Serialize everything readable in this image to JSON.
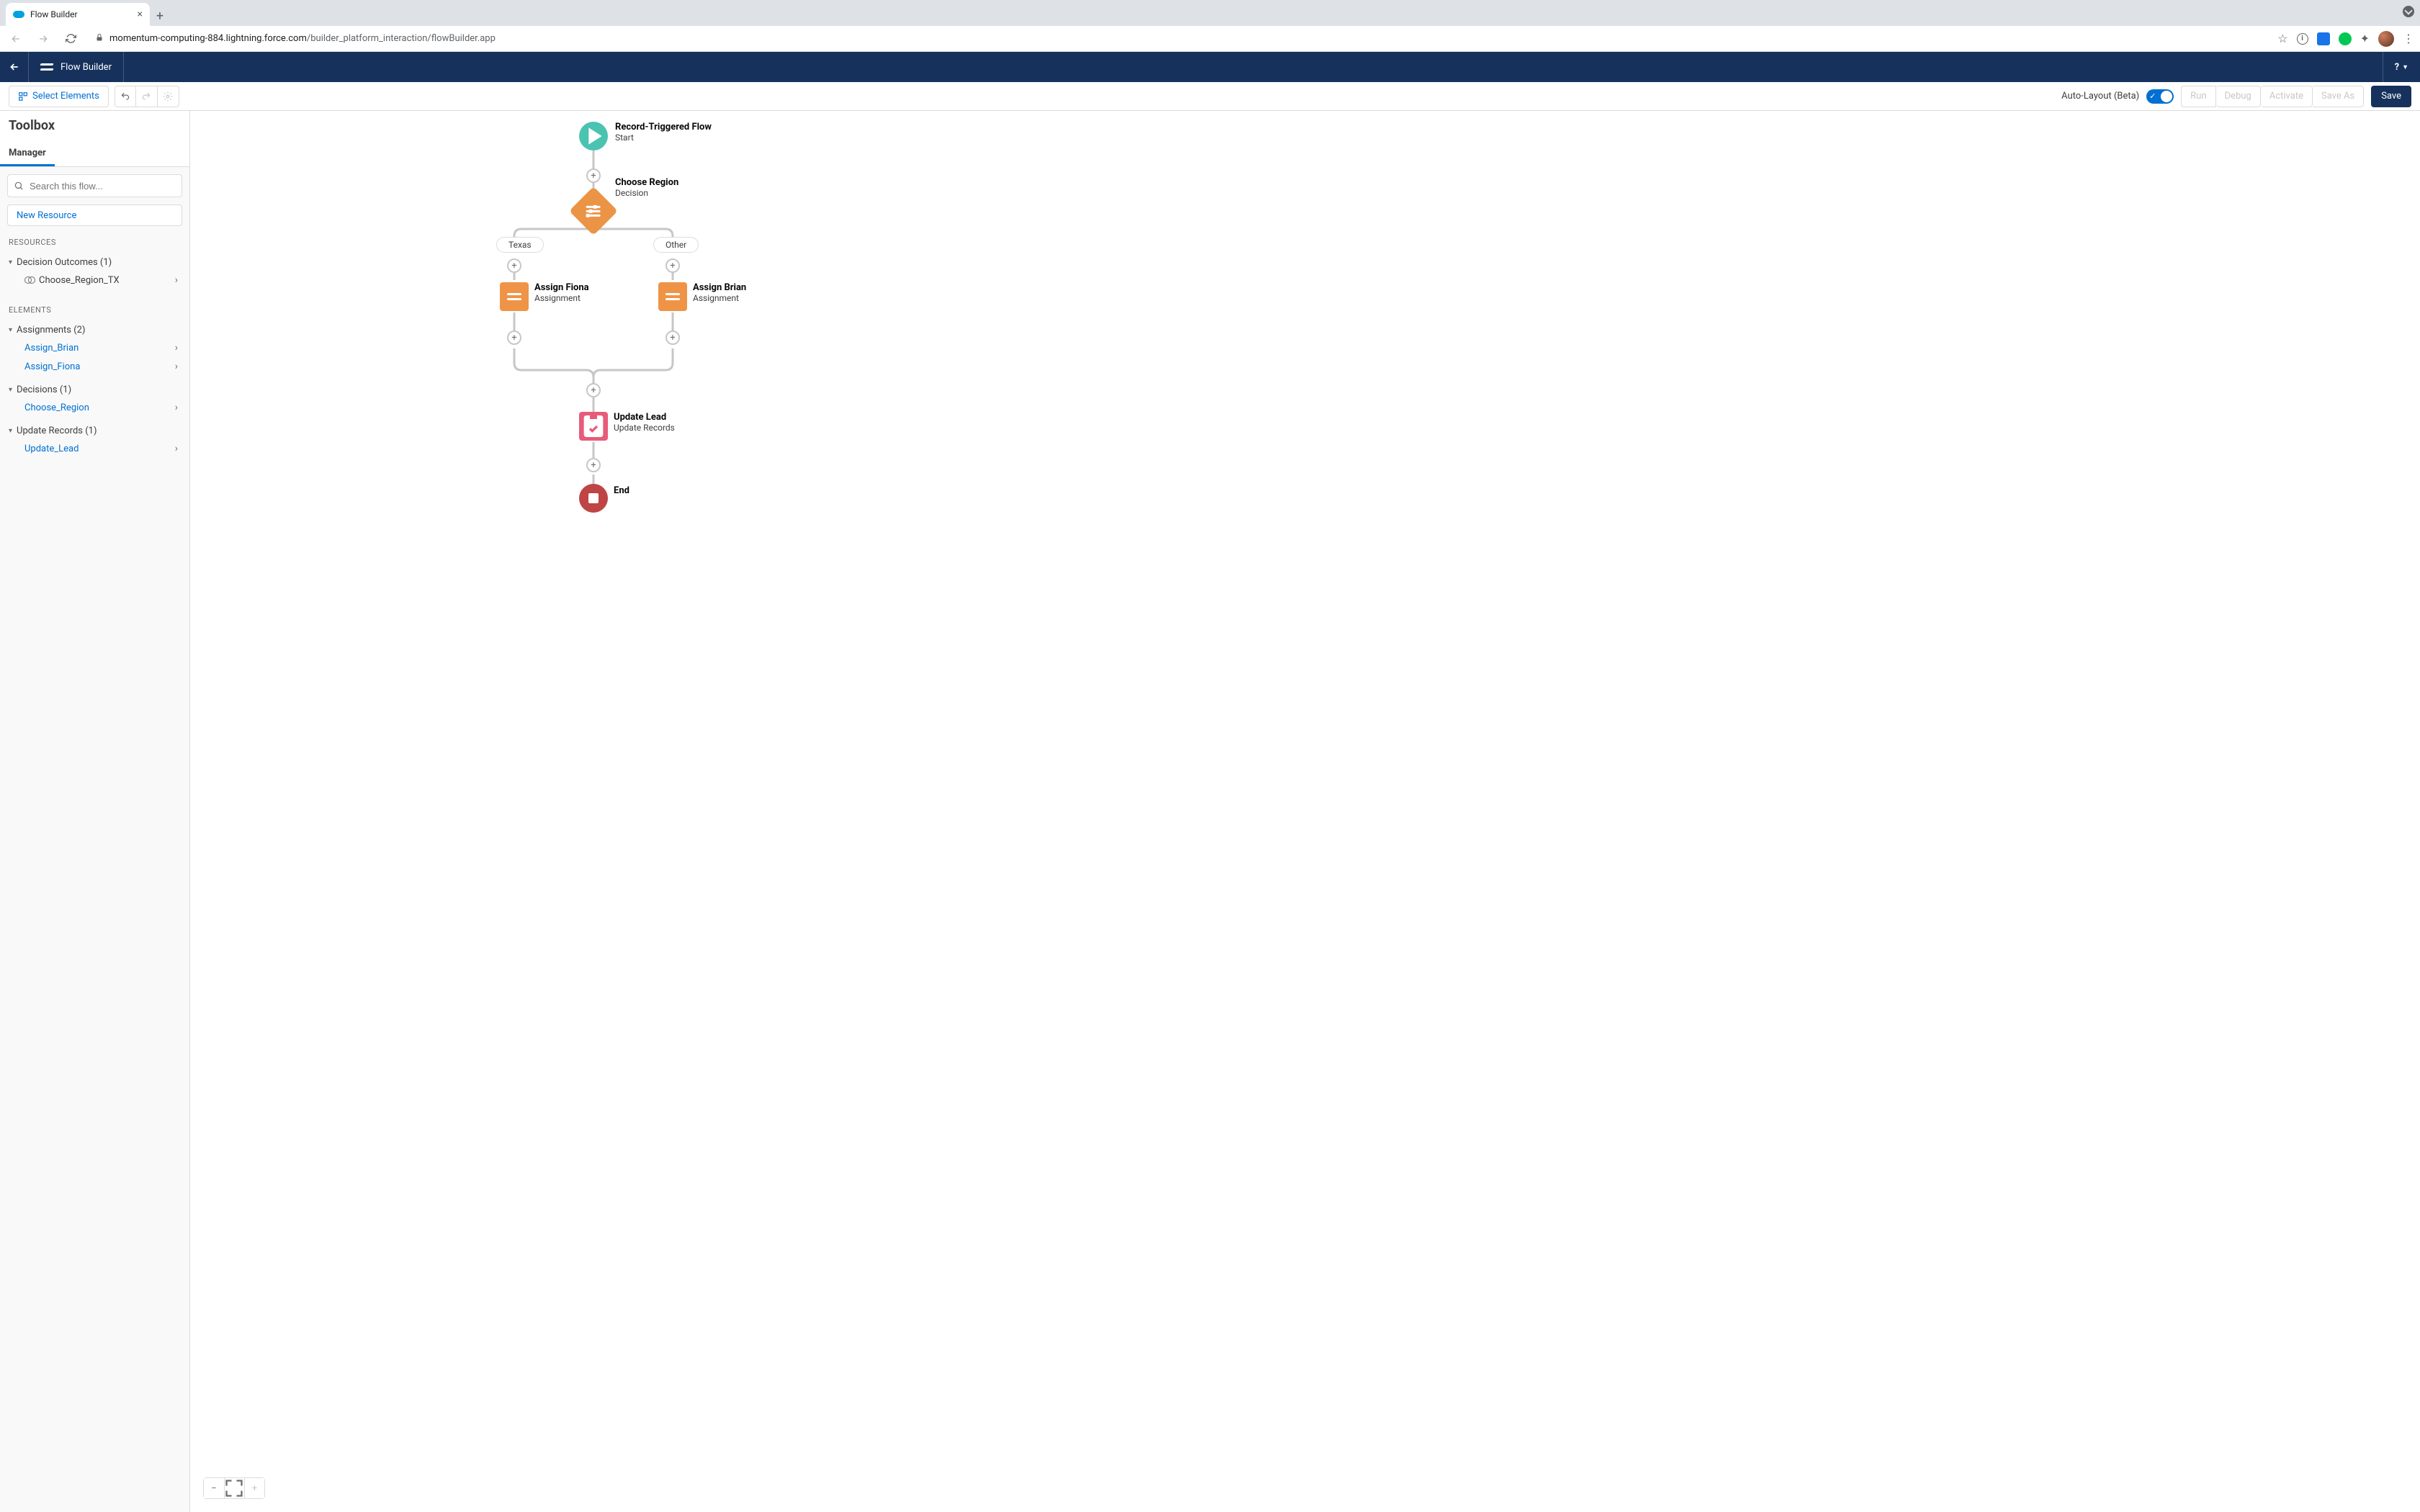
{
  "browser": {
    "tab_title": "Flow Builder",
    "url_host": "momentum-computing-884.lightning.force.com",
    "url_path": "/builder_platform_interaction/flowBuilder.app"
  },
  "nav": {
    "title": "Flow Builder",
    "help": "?"
  },
  "toolbar": {
    "select_elements": "Select Elements",
    "auto_layout": "Auto-Layout (Beta)",
    "run": "Run",
    "debug": "Debug",
    "activate": "Activate",
    "save_as": "Save As",
    "save": "Save"
  },
  "sidebar": {
    "title": "Toolbox",
    "tab": "Manager",
    "search_placeholder": "Search this flow...",
    "new_resource": "New Resource",
    "resources_label": "RESOURCES",
    "elements_label": "ELEMENTS",
    "decision_outcomes_group": "Decision Outcomes (1)",
    "decision_outcomes": [
      {
        "name": "Choose_Region_TX"
      }
    ],
    "assignments_group": "Assignments (2)",
    "assignments": [
      {
        "name": "Assign_Brian"
      },
      {
        "name": "Assign_Fiona"
      }
    ],
    "decisions_group": "Decisions (1)",
    "decisions": [
      {
        "name": "Choose_Region"
      }
    ],
    "update_records_group": "Update Records (1)",
    "update_records": [
      {
        "name": "Update_Lead"
      }
    ]
  },
  "flow": {
    "start": {
      "title": "Record-Triggered Flow",
      "subtitle": "Start"
    },
    "decision": {
      "title": "Choose Region",
      "subtitle": "Decision"
    },
    "branch_left": "Texas",
    "branch_right": "Other",
    "assign_left": {
      "title": "Assign Fiona",
      "subtitle": "Assignment"
    },
    "assign_right": {
      "title": "Assign Brian",
      "subtitle": "Assignment"
    },
    "update": {
      "title": "Update Lead",
      "subtitle": "Update Records"
    },
    "end": {
      "title": "End"
    }
  }
}
